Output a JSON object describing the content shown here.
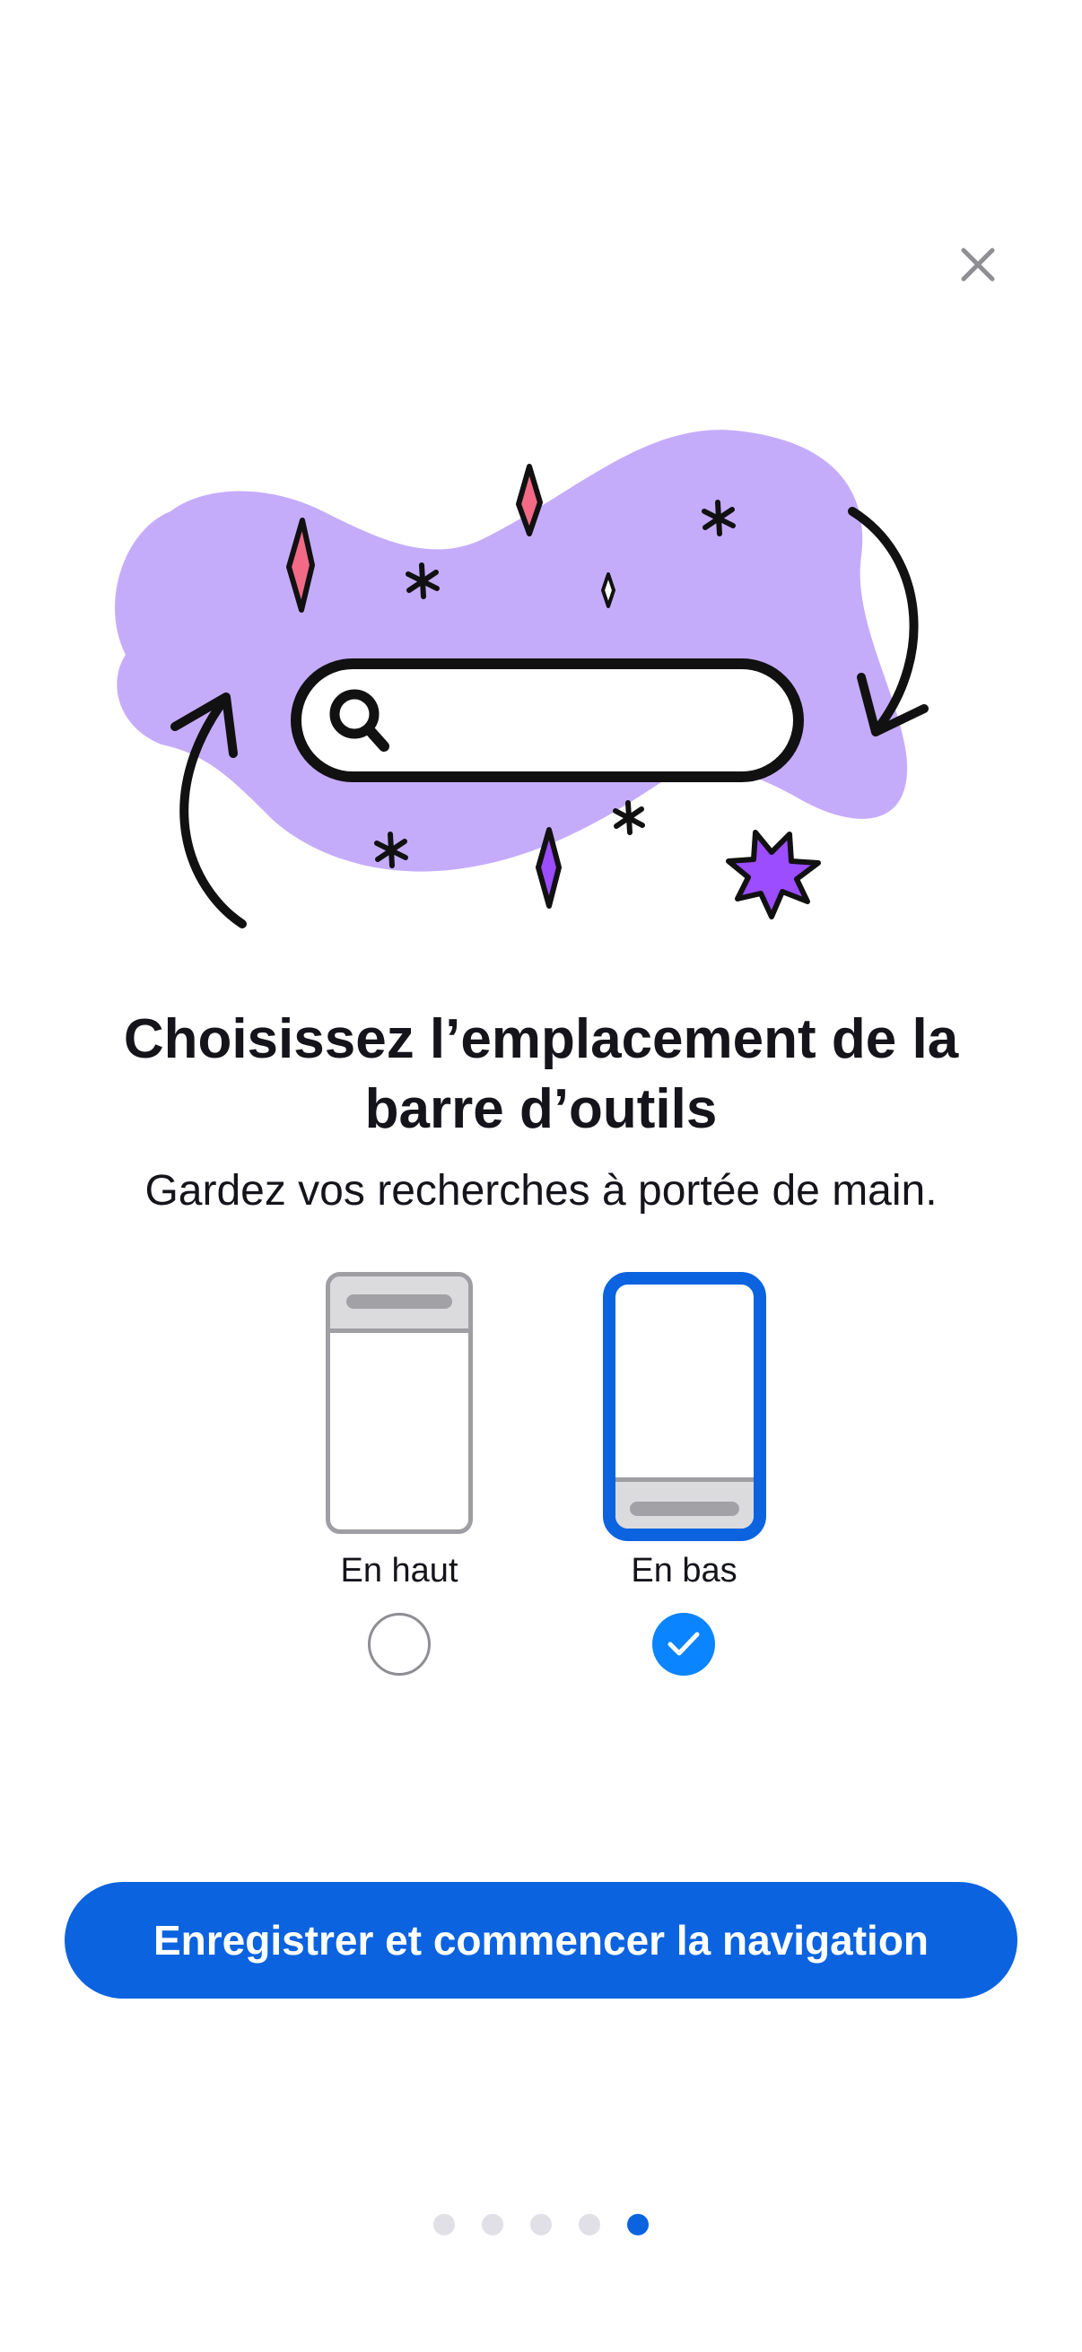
{
  "close": {
    "icon": "close-icon"
  },
  "illustration": {
    "icon": "search-icon",
    "blob_color": "#c5acfb"
  },
  "title": "Choisissez l’emplacement de la barre d’outils",
  "subtitle": "Gardez vos recherches à portée de main.",
  "options": [
    {
      "label": "En haut",
      "selected": false
    },
    {
      "label": "En bas",
      "selected": true
    }
  ],
  "primary_button": {
    "label": "Enregistrer et commencer la navigation"
  },
  "pager": {
    "total": 5,
    "current": 5
  },
  "colors": {
    "accent": "#0b63e0",
    "radio_selected": "#0a84ff",
    "blob": "#c5acfb",
    "sparkle_pink": "#f26a86",
    "sparkle_purple": "#9b4dff"
  }
}
